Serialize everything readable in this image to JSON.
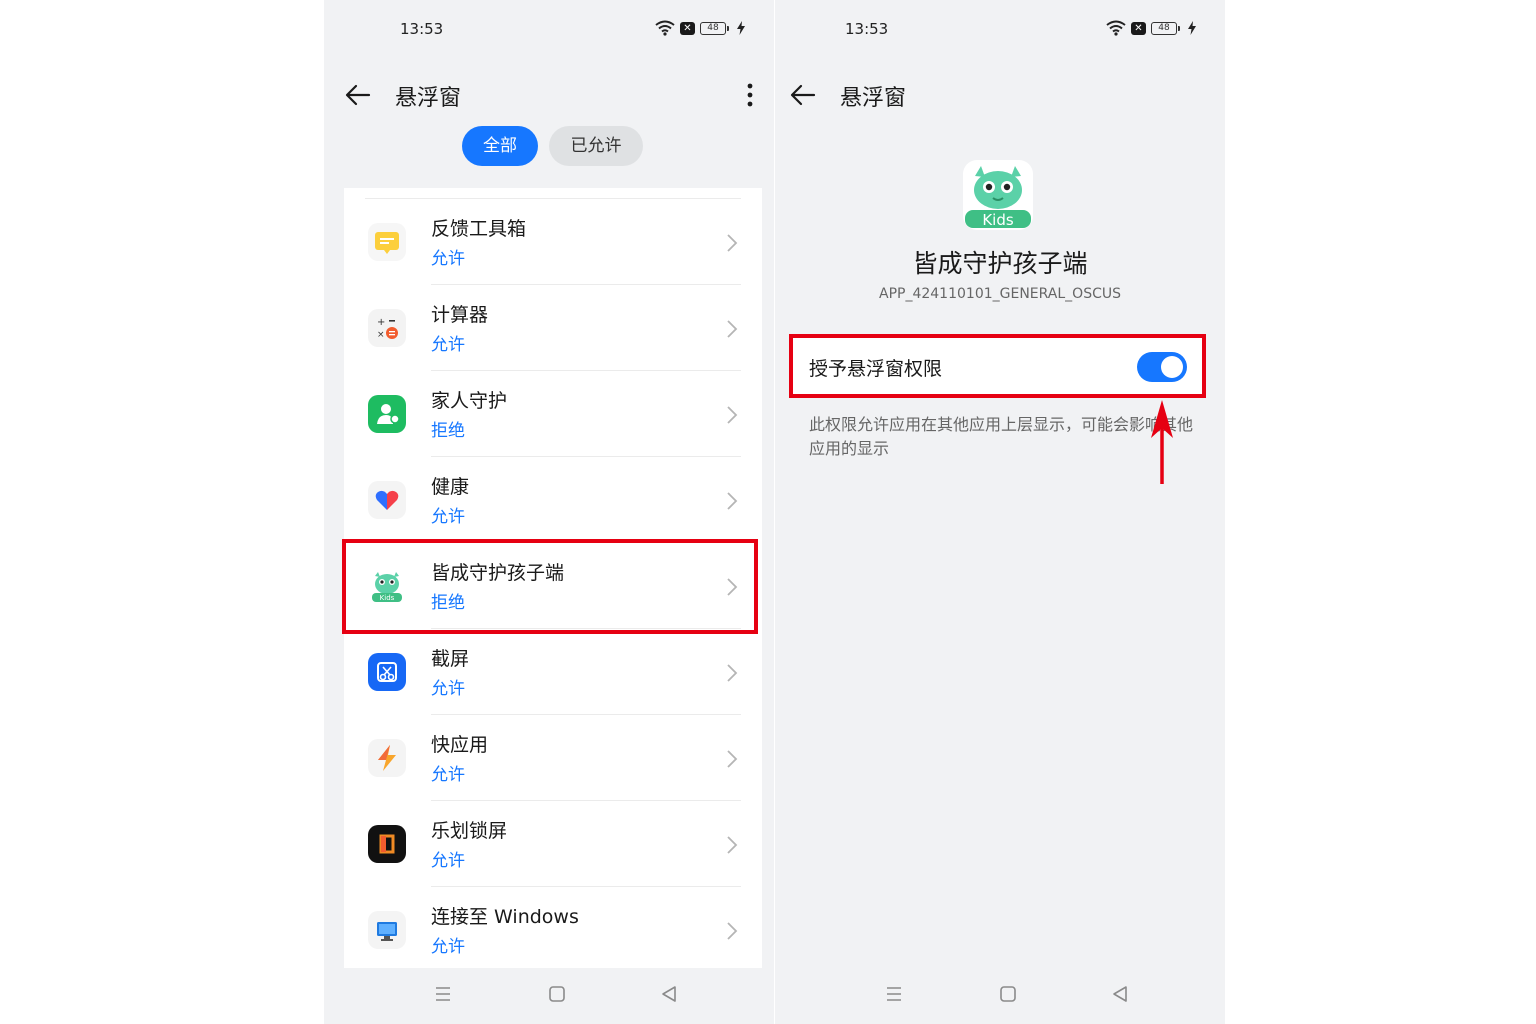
{
  "colors": {
    "accent": "#1677ff",
    "highlight": "#e60012",
    "background": "#f1f2f4"
  },
  "left": {
    "status": {
      "time": "13:53",
      "battery": "48"
    },
    "header": {
      "title": "悬浮窗"
    },
    "tabs": [
      {
        "label": "全部",
        "active": true
      },
      {
        "label": "已允许",
        "active": false
      }
    ],
    "apps": [
      {
        "name": "反馈工具箱",
        "status": "允许",
        "icon": "feedback-toolbox-icon"
      },
      {
        "name": "计算器",
        "status": "允许",
        "icon": "calculator-icon"
      },
      {
        "name": "家人守护",
        "status": "拒绝",
        "icon": "family-guard-icon"
      },
      {
        "name": "健康",
        "status": "允许",
        "icon": "health-heart-icon"
      },
      {
        "name": "皆成守护孩子端",
        "status": "拒绝",
        "icon": "kids-app-icon"
      },
      {
        "name": "截屏",
        "status": "允许",
        "icon": "screenshot-icon"
      },
      {
        "name": "快应用",
        "status": "允许",
        "icon": "quick-app-icon"
      },
      {
        "name": "乐划锁屏",
        "status": "允许",
        "icon": "lock-screen-icon"
      },
      {
        "name": "连接至 Windows",
        "status": "允许",
        "icon": "connect-windows-icon"
      }
    ]
  },
  "right": {
    "status": {
      "time": "13:53",
      "battery": "48"
    },
    "header": {
      "title": "悬浮窗"
    },
    "app": {
      "name": "皆成守护孩子端",
      "package": "APP_424110101_GENERAL_OSCUS",
      "icon_text": "Kids"
    },
    "permission": {
      "label": "授予悬浮窗权限",
      "enabled": true,
      "description": "此权限允许应用在其他应用上层显示，可能会影响其他应用的显示"
    }
  }
}
